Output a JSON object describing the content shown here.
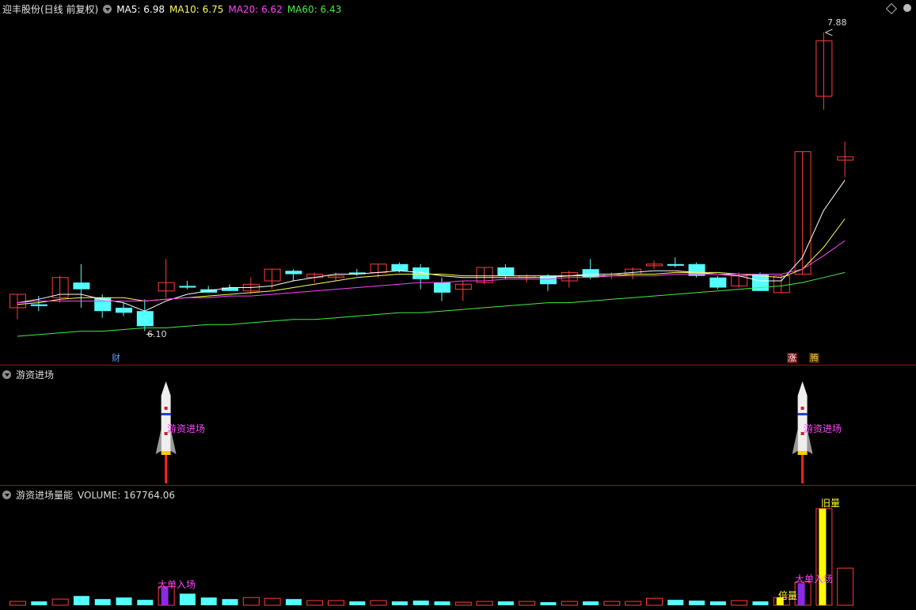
{
  "main": {
    "title": "迎丰股份(日线 前复权)",
    "ma": [
      {
        "label": "MA5: 6.98",
        "color": "#ffffff"
      },
      {
        "label": "MA10: 6.75",
        "color": "#ffff55"
      },
      {
        "label": "MA20: 6.62",
        "color": "#ff44ff"
      },
      {
        "label": "MA60: 6.43",
        "color": "#44ee44"
      }
    ],
    "high_label": "7.88",
    "low_label": "6.10",
    "fin_tag": "财",
    "zhang_tag": "涨",
    "teng_tag": "腾"
  },
  "panel2": {
    "title": "游资进场",
    "signal_label": "游资进场"
  },
  "panel3": {
    "title": "游资进场量能",
    "volume_label": "VOLUME: 167764.06",
    "big_order_label": "大单入场",
    "double_label": "倍量",
    "top_label": "旧量"
  },
  "chart_data": {
    "type": "candlestick",
    "price_range": [
      6.05,
      7.95
    ],
    "candles": [
      {
        "o": 6.22,
        "h": 6.3,
        "l": 6.15,
        "c": 6.3
      },
      {
        "o": 6.24,
        "h": 6.29,
        "l": 6.2,
        "c": 6.23
      },
      {
        "o": 6.28,
        "h": 6.41,
        "l": 6.25,
        "c": 6.4
      },
      {
        "o": 6.37,
        "h": 6.48,
        "l": 6.22,
        "c": 6.33
      },
      {
        "o": 6.28,
        "h": 6.3,
        "l": 6.16,
        "c": 6.2
      },
      {
        "o": 6.22,
        "h": 6.25,
        "l": 6.17,
        "c": 6.19
      },
      {
        "o": 6.2,
        "h": 6.27,
        "l": 6.08,
        "c": 6.11
      },
      {
        "o": 6.32,
        "h": 6.51,
        "l": 6.28,
        "c": 6.37
      },
      {
        "o": 6.35,
        "h": 6.38,
        "l": 6.33,
        "c": 6.34
      },
      {
        "o": 6.33,
        "h": 6.35,
        "l": 6.31,
        "c": 6.31
      },
      {
        "o": 6.34,
        "h": 6.36,
        "l": 6.32,
        "c": 6.32
      },
      {
        "o": 6.32,
        "h": 6.4,
        "l": 6.3,
        "c": 6.36
      },
      {
        "o": 6.38,
        "h": 6.45,
        "l": 6.33,
        "c": 6.45
      },
      {
        "o": 6.44,
        "h": 6.45,
        "l": 6.38,
        "c": 6.42
      },
      {
        "o": 6.4,
        "h": 6.43,
        "l": 6.37,
        "c": 6.42
      },
      {
        "o": 6.4,
        "h": 6.43,
        "l": 6.38,
        "c": 6.41
      },
      {
        "o": 6.43,
        "h": 6.45,
        "l": 6.41,
        "c": 6.42
      },
      {
        "o": 6.43,
        "h": 6.48,
        "l": 6.4,
        "c": 6.48
      },
      {
        "o": 6.48,
        "h": 6.49,
        "l": 6.43,
        "c": 6.44
      },
      {
        "o": 6.46,
        "h": 6.48,
        "l": 6.33,
        "c": 6.39
      },
      {
        "o": 6.37,
        "h": 6.4,
        "l": 6.26,
        "c": 6.31
      },
      {
        "o": 6.33,
        "h": 6.38,
        "l": 6.26,
        "c": 6.36
      },
      {
        "o": 6.37,
        "h": 6.46,
        "l": 6.36,
        "c": 6.46
      },
      {
        "o": 6.46,
        "h": 6.48,
        "l": 6.39,
        "c": 6.41
      },
      {
        "o": 6.4,
        "h": 6.42,
        "l": 6.37,
        "c": 6.41
      },
      {
        "o": 6.41,
        "h": 6.42,
        "l": 6.32,
        "c": 6.36
      },
      {
        "o": 6.38,
        "h": 6.44,
        "l": 6.34,
        "c": 6.43
      },
      {
        "o": 6.45,
        "h": 6.51,
        "l": 6.39,
        "c": 6.4
      },
      {
        "o": 6.41,
        "h": 6.43,
        "l": 6.39,
        "c": 6.42
      },
      {
        "o": 6.42,
        "h": 6.46,
        "l": 6.39,
        "c": 6.45
      },
      {
        "o": 6.47,
        "h": 6.5,
        "l": 6.45,
        "c": 6.48
      },
      {
        "o": 6.48,
        "h": 6.52,
        "l": 6.46,
        "c": 6.47
      },
      {
        "o": 6.48,
        "h": 6.49,
        "l": 6.4,
        "c": 6.41
      },
      {
        "o": 6.4,
        "h": 6.41,
        "l": 6.33,
        "c": 6.34
      },
      {
        "o": 6.35,
        "h": 6.43,
        "l": 6.34,
        "c": 6.41
      },
      {
        "o": 6.42,
        "h": 6.43,
        "l": 6.32,
        "c": 6.32
      },
      {
        "o": 6.31,
        "h": 6.42,
        "l": 6.31,
        "c": 6.41
      },
      {
        "o": 6.42,
        "h": 7.15,
        "l": 6.42,
        "c": 7.15
      },
      {
        "o": 7.48,
        "h": 7.86,
        "l": 7.4,
        "c": 7.81
      },
      {
        "o": 7.1,
        "h": 7.21,
        "l": 7.0,
        "c": 7.12
      }
    ],
    "ma5": [
      6.25,
      6.27,
      6.3,
      6.3,
      6.27,
      6.25,
      6.2,
      6.26,
      6.3,
      6.32,
      6.34,
      6.34,
      6.35,
      6.38,
      6.4,
      6.42,
      6.42,
      6.43,
      6.44,
      6.43,
      6.41,
      6.4,
      6.4,
      6.4,
      6.4,
      6.4,
      6.41,
      6.42,
      6.42,
      6.43,
      6.44,
      6.44,
      6.43,
      6.42,
      6.41,
      6.38,
      6.38,
      6.52,
      6.8,
      6.98
    ],
    "ma10": [
      6.24,
      6.25,
      6.27,
      6.28,
      6.28,
      6.28,
      6.26,
      6.27,
      6.28,
      6.29,
      6.3,
      6.31,
      6.32,
      6.34,
      6.36,
      6.38,
      6.4,
      6.41,
      6.42,
      6.42,
      6.42,
      6.41,
      6.41,
      6.41,
      6.41,
      6.41,
      6.41,
      6.41,
      6.41,
      6.42,
      6.42,
      6.43,
      6.43,
      6.43,
      6.42,
      6.41,
      6.4,
      6.45,
      6.58,
      6.75
    ],
    "ma20": [
      6.25,
      6.26,
      6.26,
      6.26,
      6.26,
      6.26,
      6.26,
      6.27,
      6.28,
      6.28,
      6.29,
      6.29,
      6.3,
      6.31,
      6.32,
      6.33,
      6.34,
      6.35,
      6.36,
      6.37,
      6.37,
      6.38,
      6.38,
      6.39,
      6.39,
      6.39,
      6.4,
      6.4,
      6.41,
      6.41,
      6.41,
      6.42,
      6.42,
      6.42,
      6.42,
      6.42,
      6.42,
      6.45,
      6.53,
      6.62
    ],
    "ma60": [
      6.05,
      6.06,
      6.07,
      6.08,
      6.08,
      6.09,
      6.1,
      6.1,
      6.11,
      6.12,
      6.12,
      6.13,
      6.14,
      6.15,
      6.15,
      6.16,
      6.17,
      6.18,
      6.19,
      6.19,
      6.2,
      6.21,
      6.22,
      6.23,
      6.24,
      6.25,
      6.25,
      6.26,
      6.27,
      6.28,
      6.29,
      6.3,
      6.31,
      6.32,
      6.33,
      6.34,
      6.35,
      6.37,
      6.4,
      6.43
    ],
    "volume": [
      5,
      5,
      8,
      12,
      8,
      10,
      7,
      24,
      15,
      10,
      8,
      10,
      9,
      8,
      6,
      6,
      5,
      6,
      5,
      6,
      5,
      4,
      5,
      5,
      5,
      4,
      5,
      5,
      5,
      5,
      9,
      7,
      6,
      5,
      6,
      5,
      10,
      30,
      125,
      48
    ],
    "volume_max": 130,
    "big_order_idx": [
      7,
      37
    ],
    "double_idx": [
      36
    ],
    "top_idx": [
      38
    ],
    "signal_idx": [
      7,
      37
    ]
  }
}
